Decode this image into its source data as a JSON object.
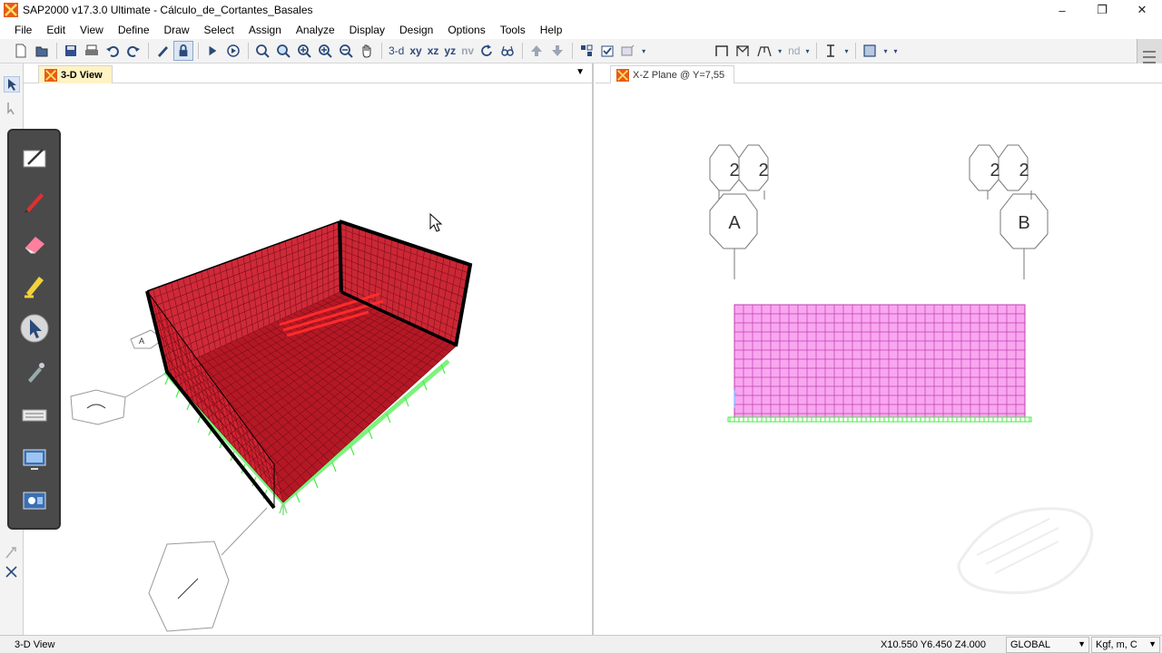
{
  "window": {
    "title": "SAP2000 v17.3.0 Ultimate  - Cálculo_de_Cortantes_Basales",
    "controls": [
      "–",
      "❐",
      "✕"
    ]
  },
  "menu": [
    "File",
    "Edit",
    "View",
    "Define",
    "Draw",
    "Select",
    "Assign",
    "Analyze",
    "Display",
    "Design",
    "Options",
    "Tools",
    "Help"
  ],
  "toolbar": {
    "view_buttons": [
      "3-d",
      "xy",
      "xz",
      "yz",
      "nv"
    ],
    "nd_label": "nd"
  },
  "left_pane": {
    "tab_label": "3-D View",
    "dropdown_glyph": "▼",
    "grid_bubble_label": "A"
  },
  "right_pane": {
    "tab_label": "X-Z Plane @ Y=7,55",
    "bubbles_top": [
      "2",
      "2",
      "2",
      "2"
    ],
    "bubble_a": "A",
    "bubble_b": "B"
  },
  "status": {
    "view_name": "3-D View",
    "coordinates": "X10.550  Y6.450  Z4.000",
    "coord_system": "GLOBAL",
    "units": "Kgf, m, C"
  },
  "colors": {
    "mesh_red": "#cc1f2e",
    "mesh_pink": "#f9a6f0",
    "support_green": "#44ee44",
    "tab_active_bg": "#fff3c4"
  }
}
